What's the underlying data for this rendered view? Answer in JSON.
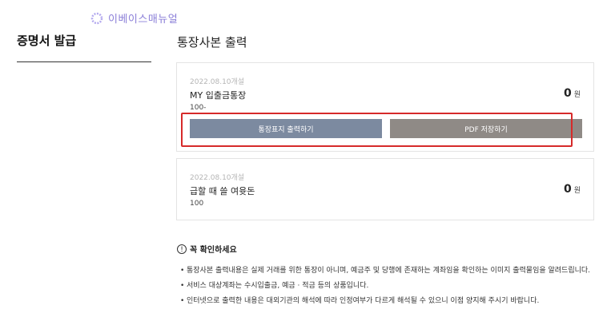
{
  "brand": {
    "text": "이베이스매뉴얼"
  },
  "sidebar": {
    "title": "증명서 발급"
  },
  "main": {
    "title": "통장사본 출력"
  },
  "accounts": [
    {
      "open_date": "2022.08.10개설",
      "name": "MY 입출금통장",
      "number": "100-",
      "balance": "0",
      "unit": "원",
      "print_button": "통장표지 출력하기",
      "pdf_button": "PDF 저장하기"
    },
    {
      "open_date": "2022.08.10개설",
      "name": "급할 때 쓸 여윳돈",
      "number": "100",
      "balance": "0",
      "unit": "원"
    }
  ],
  "notice": {
    "title": "꼭 확인하세요",
    "items": [
      "통장사본 출력내용은 실제 거래를 위한 통장이 아니며, 예금주 및 당행에 존재하는 계좌임을 확인하는 이미지 출력물임을 알려드립니다.",
      "서비스 대상계좌는 수시입출금, 예금 · 적금 등의 상품입니다.",
      "인터넷으로 출력한 내용은 대외기관의 해석에 따라 인정여부가 다르게 해석될 수 있으니 이점 양지해 주시기 바랍니다."
    ]
  },
  "colors": {
    "print_button": "#7c8aa0",
    "pdf_button": "#8f8a86",
    "highlight": "#d62a2a",
    "brand": "#8b7fd8"
  }
}
